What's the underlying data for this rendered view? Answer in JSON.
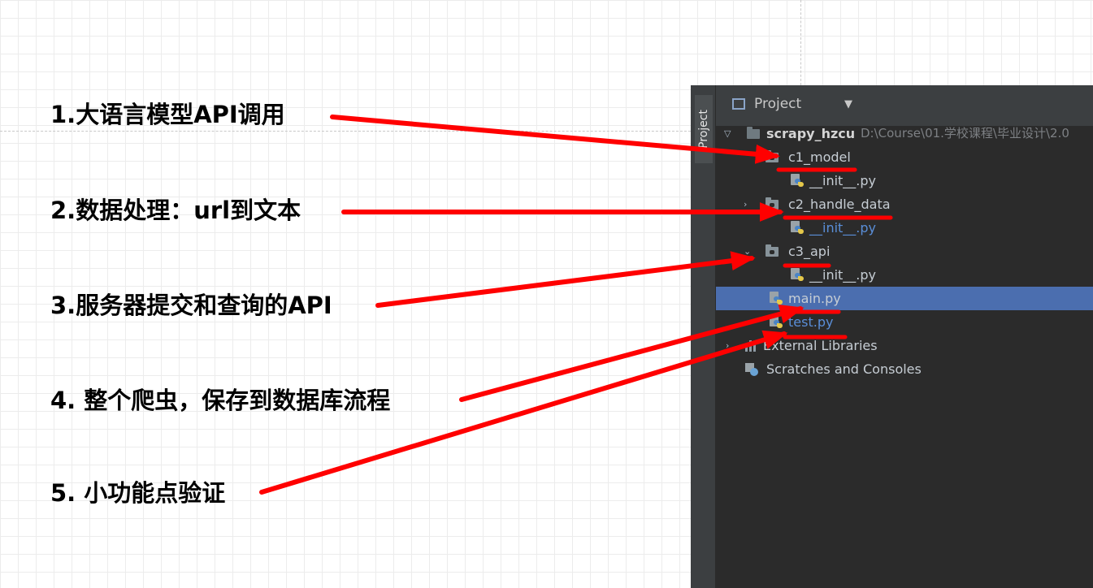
{
  "annotations": [
    "1.大语言模型API调用",
    "2.数据处理：url到文本",
    "3.服务器提交和查询的API",
    "4. 整个爬虫，保存到数据库流程",
    "5. 小功能点验证"
  ],
  "ide": {
    "side_tab_label": "Project",
    "panel_title": "Project",
    "tree": {
      "root_name": "scrapy_hzcu",
      "root_path": "D:\\Course\\01.学校课程\\毕业设计\\2.0",
      "c1_model": "c1_model",
      "c1_init": "__init__.py",
      "c2_handle_data": "c2_handle_data",
      "c2_init": "__init__.py",
      "c3_api": "c3_api",
      "c3_init": "__init__.py",
      "main": "main.py",
      "test": "test.py",
      "external_libraries": "External Libraries",
      "scratches": "Scratches and Consoles"
    }
  },
  "colors": {
    "arrow": "#ff0000",
    "selection": "#4b6eaf",
    "ide_background": "#2b2b2b"
  }
}
